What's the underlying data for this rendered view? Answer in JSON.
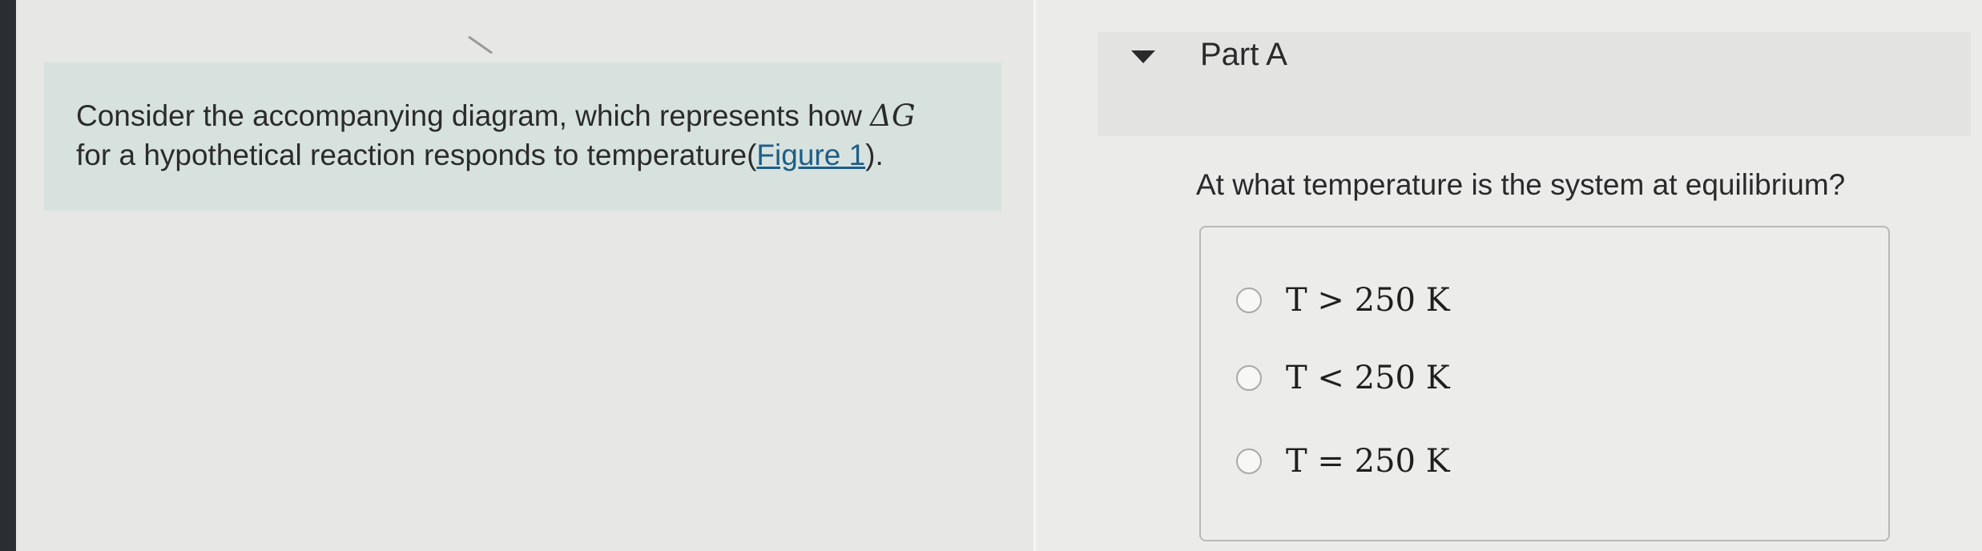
{
  "intro": {
    "text_before_link": "Consider the accompanying diagram, which represents how",
    "delta_g": "ΔG",
    "text_line2_before_link": "for a hypothetical reaction responds to temperature(",
    "figure_link": "Figure 1",
    "text_after_link": ")."
  },
  "part": {
    "title": "Part A",
    "question": "At what temperature is the system at equilibrium?"
  },
  "options": [
    {
      "label": "T > 250 K",
      "selected": false
    },
    {
      "label": "T < 250 K",
      "selected": false
    },
    {
      "label": "T = 250 K",
      "selected": false
    }
  ],
  "colors": {
    "intro_background": "#d7e2df",
    "link": "#1f5e86",
    "text": "#2a2a2a"
  }
}
